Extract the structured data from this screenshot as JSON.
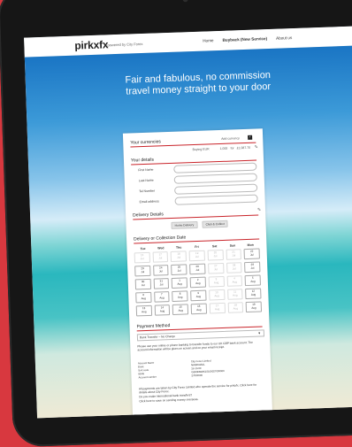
{
  "nav": {
    "logo": "pirkxfx",
    "powered": "powered by City Forex",
    "links": [
      "Home",
      "Buyback (New Service)",
      "About us"
    ]
  },
  "hero": {
    "line1": "Fair and fabulous, no commission",
    "line2": "travel money straight to your door"
  },
  "currencies": {
    "title": "Your currencies",
    "add_label": "Add currency",
    "buying": "Buying EUR",
    "rate": "1,000",
    "for_label": "for",
    "cost": "£1,087.70"
  },
  "details": {
    "title": "Your details",
    "fields": [
      "First Name",
      "Last Name",
      "Tel Number",
      "Email address"
    ]
  },
  "delivery": {
    "title": "Delivery Details",
    "options": [
      "Home Delivery",
      "Click & Collect"
    ]
  },
  "calendar": {
    "title": "Delivery or Collection Date",
    "days": [
      "Tue",
      "Wed",
      "Thu",
      "Fri",
      "Sat",
      "Sun",
      "Mon"
    ],
    "weeks": [
      [
        [
          "16",
          "Jul"
        ],
        [
          "17",
          "Jul"
        ],
        [
          "18",
          "Jul"
        ],
        [
          "19",
          "Jul"
        ],
        [
          "20",
          "Jul"
        ],
        [
          "21",
          "Jul"
        ],
        [
          "22",
          "Jul"
        ]
      ],
      [
        [
          "23",
          "Jul"
        ],
        [
          "24",
          "Jul"
        ],
        [
          "25",
          "Jul"
        ],
        [
          "26",
          "Jul"
        ],
        [
          "27",
          "Jul"
        ],
        [
          "28",
          "Jul"
        ],
        [
          "29",
          "Jul"
        ]
      ],
      [
        [
          "30",
          "Jul"
        ],
        [
          "31",
          "Jul"
        ],
        [
          "1",
          "Aug"
        ],
        [
          "2",
          "Aug"
        ],
        [
          "3",
          "Aug"
        ],
        [
          "4",
          "Aug"
        ],
        [
          "5",
          "Aug"
        ]
      ],
      [
        [
          "6",
          "Aug"
        ],
        [
          "7",
          "Aug"
        ],
        [
          "8",
          "Aug"
        ],
        [
          "9",
          "Aug"
        ],
        [
          "10",
          "Aug"
        ],
        [
          "11",
          "Aug"
        ],
        [
          "12",
          "Aug"
        ]
      ],
      [
        [
          "13",
          "Aug"
        ],
        [
          "14",
          "Aug"
        ],
        [
          "15",
          "Aug"
        ],
        [
          "16",
          "Aug"
        ],
        [
          "17",
          "Aug"
        ],
        [
          "18",
          "Aug"
        ],
        [
          "19",
          "Aug"
        ]
      ]
    ],
    "dim": [
      [
        "16",
        "17",
        "18",
        "19",
        "20",
        "21"
      ],
      [
        "27",
        "28"
      ],
      [
        "3",
        "4"
      ],
      [
        "10",
        "11"
      ],
      [
        "17",
        "18"
      ]
    ]
  },
  "payment": {
    "title": "Payment Method",
    "selected": "Bank Transfer – No Charge",
    "notice": "Please use your online or phone banking to transfer funds to our UK GBP bank account. The account information will be given on screen and on your email receipt.",
    "bank_rows": [
      [
        "Account Name",
        "City Forex Limited"
      ],
      [
        "Bank",
        "NWBKGB2L"
      ],
      [
        "Sort code",
        "15-10-00"
      ],
      [
        "IBAN",
        "GB00NWBK15100027000000"
      ],
      [
        "Account number",
        "27000000"
      ]
    ],
    "footer1": "All payments are taken by City Forex Limited who operate the service for pirkxfx. Click here for details about City Forex.",
    "footer2": "Do you make international bank transfers?",
    "footer3": "Click here to save on sending money overseas."
  },
  "colors": {
    "accent": "#c9242a",
    "background": "#d8383f"
  }
}
